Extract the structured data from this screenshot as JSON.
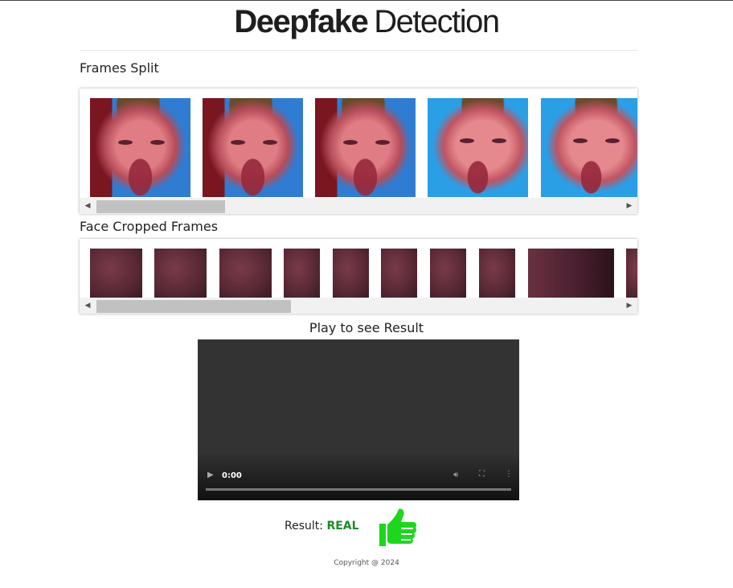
{
  "header": {
    "title_bold": "Deepfake",
    "title_light": "Detection"
  },
  "frames_split": {
    "title": "Frames Split",
    "frames": [
      "frame-1",
      "frame-2",
      "frame-3",
      "frame-4",
      "frame-5"
    ]
  },
  "face_cropped": {
    "title": "Face Cropped Frames",
    "frames": [
      "crop-1",
      "crop-2",
      "crop-3",
      "crop-4",
      "crop-5",
      "crop-6",
      "crop-7",
      "crop-8",
      "crop-9",
      "crop-10"
    ]
  },
  "video": {
    "caption": "Play to see Result",
    "time": "0:00",
    "icons": {
      "play": "play-icon",
      "volume": "volume-icon",
      "fullscreen": "fullscreen-icon",
      "more": "more-options-icon"
    }
  },
  "result": {
    "label": "Result:",
    "value": "REAL",
    "value_color": "#1e8a2a",
    "icon": "thumbs-up-icon",
    "icon_color": "#1fd61f"
  },
  "footer": {
    "copyright": "Copyright @ 2024"
  }
}
